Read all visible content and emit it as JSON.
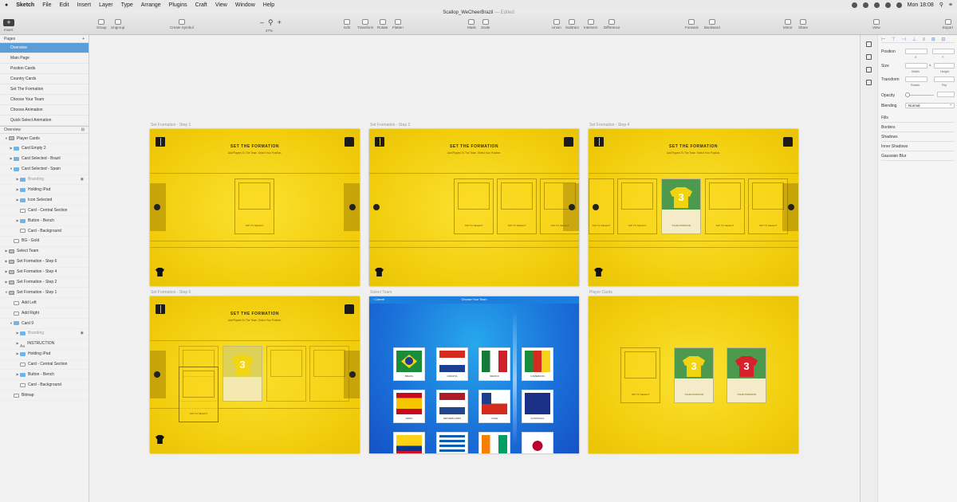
{
  "menubar": {
    "app": "Sketch",
    "items": [
      "File",
      "Edit",
      "Insert",
      "Layer",
      "Type",
      "Arrange",
      "Plugins",
      "Craft",
      "View",
      "Window",
      "Help"
    ],
    "clock": "Mon 18:08"
  },
  "window": {
    "doc_title": "Scallop_WeCheerBrazil",
    "doc_state": "— Edited",
    "zoom": "27%"
  },
  "toolbar": {
    "insert": "Insert",
    "group": "Group",
    "ungroup": "Ungroup",
    "create_symbol": "Create Symbol",
    "edit": "Edit",
    "transform": "Transform",
    "rotate": "Rotate",
    "flatten": "Flatten",
    "mask": "Mask",
    "scale": "Scale",
    "union": "Union",
    "subtract": "Subtract",
    "intersect": "Intersect",
    "difference": "Difference",
    "forward": "Forward",
    "backward": "Backward",
    "mirror": "Mirror",
    "share": "Share",
    "view": "View",
    "export": "Export"
  },
  "pages": {
    "header": "Pages",
    "add": "+",
    "items": [
      "Overview",
      "Main Page",
      "Positon Cards",
      "Country Cards",
      "Set The Formation",
      "Choose Your Team",
      "Choose Animation",
      "Quick Select Animation"
    ]
  },
  "layers": {
    "header": "Overview",
    "items": [
      {
        "label": "Player Cards",
        "tri": "▼",
        "icon": "art",
        "dim": false
      },
      {
        "label": "Card Empty 2",
        "tri": "▶",
        "icon": "folder",
        "dim": false
      },
      {
        "label": "Card Selected - Brazil",
        "tri": "▶",
        "icon": "folder",
        "dim": false
      },
      {
        "label": "Card Selected - Spain",
        "tri": "▼",
        "icon": "folder",
        "dim": false
      },
      {
        "label": "Branding",
        "tri": "▶",
        "icon": "folder",
        "dim": true,
        "eye": true
      },
      {
        "label": "Holding iPad",
        "tri": "▶",
        "icon": "folder",
        "dim": false
      },
      {
        "label": "Icon Selected",
        "tri": "▶",
        "icon": "folder",
        "dim": false
      },
      {
        "label": "Card - Central Section",
        "tri": "",
        "icon": "rect",
        "dim": false
      },
      {
        "label": "Button - Bench",
        "tri": "▶",
        "icon": "folder",
        "dim": false
      },
      {
        "label": "Card - Background",
        "tri": "",
        "icon": "rect",
        "dim": false
      },
      {
        "label": "BG - Gold",
        "tri": "",
        "icon": "rect",
        "dim": false
      },
      {
        "label": "Select Team",
        "tri": "▶",
        "icon": "art",
        "dim": false
      },
      {
        "label": "Set Formation - Step 6",
        "tri": "▶",
        "icon": "art",
        "dim": false
      },
      {
        "label": "Set Formation - Step 4",
        "tri": "▶",
        "icon": "art",
        "dim": false
      },
      {
        "label": "Set Formation - Step 2",
        "tri": "▶",
        "icon": "art",
        "dim": false
      },
      {
        "label": "Set Formation - Step 1",
        "tri": "▼",
        "icon": "art",
        "dim": false
      },
      {
        "label": "Add Left",
        "tri": "",
        "icon": "rect",
        "dim": false
      },
      {
        "label": "Add Right",
        "tri": "",
        "icon": "rect",
        "dim": false
      },
      {
        "label": "Card 9",
        "tri": "▼",
        "icon": "folder",
        "dim": false
      },
      {
        "label": "Branding",
        "tri": "▶",
        "icon": "folder",
        "dim": true,
        "eye": true
      },
      {
        "label": "INSTRUCTION",
        "tri": "▶",
        "icon": "txt",
        "dim": false
      },
      {
        "label": "Holding iPad",
        "tri": "▶",
        "icon": "folder",
        "dim": false
      },
      {
        "label": "Card - Central Section",
        "tri": "",
        "icon": "rect",
        "dim": false
      },
      {
        "label": "Button - Bench",
        "tri": "▶",
        "icon": "folder",
        "dim": false
      },
      {
        "label": "Card - Background",
        "tri": "",
        "icon": "rect",
        "dim": false
      },
      {
        "label": "Bitmap",
        "tri": "",
        "icon": "rect",
        "dim": false
      }
    ]
  },
  "inspector": {
    "position": "Position",
    "x": "X",
    "y": "Y",
    "size": "Size",
    "width": "Width",
    "height": "Height",
    "transform": "Transform",
    "rotate": "Rotate",
    "flip": "Flip",
    "opacity": "Opacity",
    "blending": "Blending",
    "blending_value": "Normal",
    "sections": [
      "Fills",
      "Borders",
      "Shadows",
      "Inner Shadows",
      "Gaussian Blur"
    ]
  },
  "artboards": {
    "step1_label": "Set Formation - Step 1",
    "step2_label": "Set Formation - Step 2",
    "step4_label": "Set Formation - Step 4",
    "step6_label": "Set Formation - Step 6",
    "team_label": "Select Team",
    "player_label": "Player Cards",
    "heading": "SET THE FORMATION",
    "subheading": "Add Players To The Team. Select Your Position.",
    "card_text": "TAP TO SELECT",
    "position_label": "YOUR POSITION",
    "jersey_number": "3",
    "team_bar_title": "Choose Your Team",
    "team_cancel": "Cancel",
    "flags": [
      {
        "name": "BRAZIL"
      },
      {
        "name": "CROATIA"
      },
      {
        "name": "MEXICO"
      },
      {
        "name": "CAMEROON"
      },
      {
        "name": "SPAIN"
      },
      {
        "name": "NETHERLANDS"
      },
      {
        "name": "CHILE"
      },
      {
        "name": "AUSTRALIA"
      },
      {
        "name": ""
      },
      {
        "name": ""
      },
      {
        "name": ""
      },
      {
        "name": ""
      }
    ]
  },
  "colors": {
    "selection": "#5b9dd9",
    "artboard_yellow": "#f1cd0c",
    "team_blue": "#1a6fd8",
    "card_green": "#4d9a4f",
    "jersey_red": "#d8202a"
  }
}
